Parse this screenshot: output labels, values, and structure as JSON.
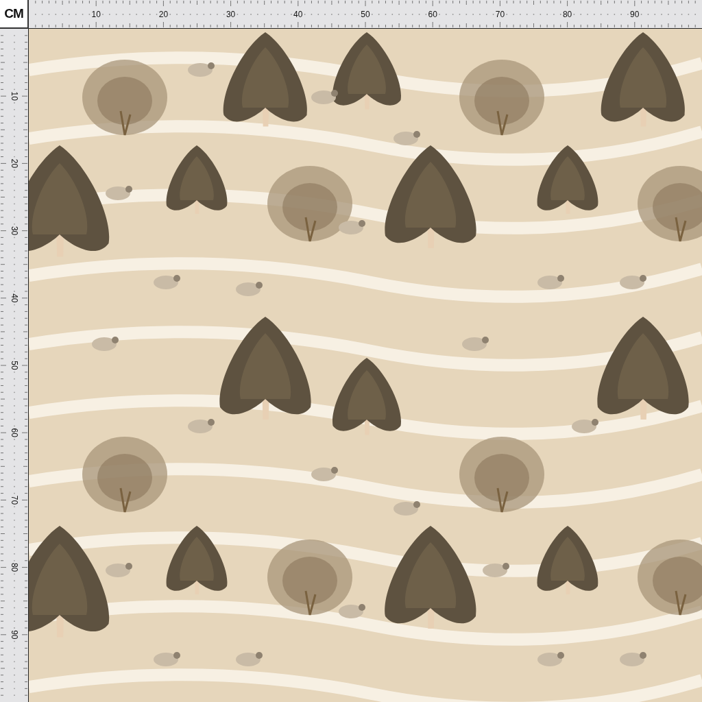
{
  "corner_label": "CM",
  "top_ruler": {
    "labels": [
      "10",
      "20",
      "30",
      "40",
      "50",
      "60",
      "70",
      "80",
      "90"
    ]
  },
  "left_ruler": {
    "labels": [
      "10",
      "20",
      "30",
      "40",
      "50",
      "60",
      "70",
      "80",
      "90"
    ]
  }
}
